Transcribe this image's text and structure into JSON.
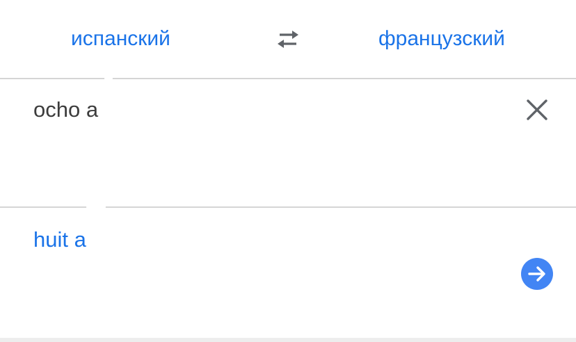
{
  "languages": {
    "source": "испанский",
    "target": "французский"
  },
  "input": {
    "text": "ocho a"
  },
  "output": {
    "text": "huit a"
  },
  "icons": {
    "swap": "swap-arrows-icon",
    "clear": "close-icon",
    "go": "arrow-right-icon"
  },
  "colors": {
    "accent": "#1a73e8",
    "button": "#4285f4",
    "text": "#3c3c3c",
    "icon": "#5f6368",
    "divider": "#d5d5d5"
  }
}
